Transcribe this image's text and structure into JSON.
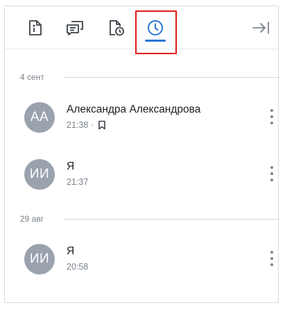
{
  "tabs": [
    {
      "icon": "file-info-icon",
      "active": false
    },
    {
      "icon": "chat-bubbles-icon",
      "active": false
    },
    {
      "icon": "document-clock-icon",
      "active": false
    },
    {
      "icon": "clock-icon",
      "active": true
    }
  ],
  "accent_color": "#2b74d6",
  "highlight_color": "#e11b1b",
  "collapse_icon": "collapse-right-icon",
  "groups": [
    {
      "date": "4 сент",
      "items": [
        {
          "initials": "АА",
          "name": "Александра Александрова",
          "time": "21:38",
          "separator": "·",
          "bookmarked": true
        },
        {
          "initials": "ИИ",
          "name": "Я",
          "time": "21:37",
          "bookmarked": false
        }
      ]
    },
    {
      "date": "29 авг",
      "items": [
        {
          "initials": "ИИ",
          "name": "Я",
          "time": "20:58",
          "bookmarked": false
        }
      ]
    }
  ]
}
